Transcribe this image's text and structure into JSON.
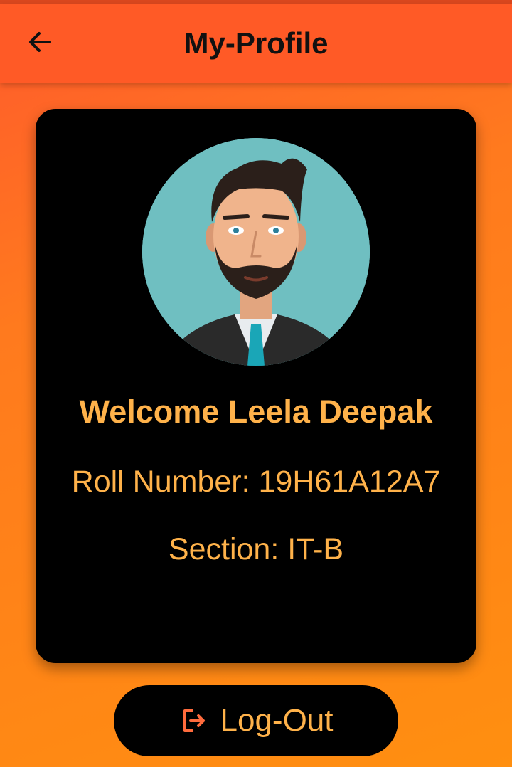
{
  "app_bar": {
    "title": "My-Profile",
    "back_icon": "arrow-left-icon"
  },
  "profile": {
    "avatar_icon": "avatar-illustration",
    "welcome": "Welcome Leela Deepak",
    "roll_number": "Roll Number: 19H61A12A7",
    "section": "Section: IT-B"
  },
  "logout": {
    "label": "Log-Out",
    "icon": "logout-icon"
  },
  "colors": {
    "app_bar": "#ff5a26",
    "background_top": "#ff5a2c",
    "background_bottom": "#ff8f10",
    "card": "#000000",
    "accent_text": "#ffb24a",
    "logout_icon": "#ff6b3d"
  }
}
